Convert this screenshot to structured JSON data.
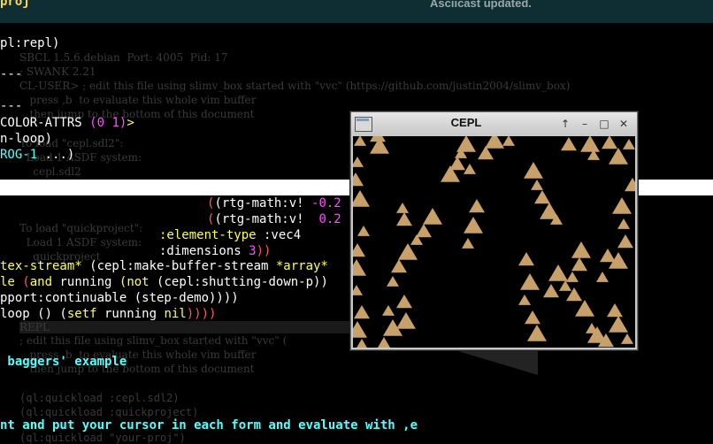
{
  "topbar": {
    "left_text": "proj",
    "right_text": "Asciicast updated."
  },
  "editor": {
    "l1": "pl:repl)",
    "l2": "---",
    "l3": "---",
    "l4a": "COLOR-ATTRS ",
    "l4b": "(0 1)",
    "l4c": ">",
    "l5": "n-loop)",
    "l6a": "ROG-1",
    "l6b": " ...)",
    "l7a": "(rtg-math:v! ",
    "l7b": "-0.2",
    "l8a": "(rtg-math:v!  ",
    "l8b": "0.2",
    "l9a": ":element-type",
    "l9b": " :vec4",
    "l10a": ":dimensions ",
    "l10b": "3",
    "l10c": "))",
    "l11a": "tex-stream*",
    "l11b": " (cepl:make-buffer-stream ",
    "l11c": "*array*",
    "l12a": "le ",
    "l12b": "(",
    "l12c": "and",
    "l12d": " running ",
    "l12e": "(not",
    "l12f": " (cepl:shutting-down-p))",
    "l13": "pport:continuable (step-demo))))",
    "l14a": "loop () (",
    "l14b": "setf",
    "l14c": " running ",
    "l14d": "nil",
    "l14e": "))))",
    "l15": " baggers' example",
    "l16": "nt and put your cursor in each form and evaluate with ,e"
  },
  "background_text": {
    "d1": "SBCL 1.5.6.debian  Port: 4005  Pid: 17",
    "d2": "; SWANK 2.21",
    "d3": "CL-USER> ; edit this file using slimv_box started with \"vvc\" (https://github.com/justin2004/slimv_box)",
    "d4": "   press ,b  to evaluate this whole vim buffer",
    "d5": "   then jump to the bottom of this document",
    "d6": "To load \"cepl.sdl2\":",
    "d7": "  Load 1 ASDF system:",
    "d8": "    cepl.sdl2",
    "d9": "To load \"quickproject\":",
    "d10": "  Load 1 ASDF system:",
    "d11": "    quickproject",
    "d12": "REPL",
    "d13": "; edit this file using slimv_box started with \"vvc\" (",
    "d14": "   press ,b  to evaluate this whole vim buffer",
    "d15": "   then jump to the bottom of this document",
    "d16": "(ql:quickload :cepl.sdl2)",
    "d17": "(ql:quickload :quickproject)",
    "d18": "(ql:quickload \"your-proj\")"
  },
  "window": {
    "title": "CEPL",
    "up": "↑",
    "min": "–",
    "max": "□",
    "close": "✕"
  },
  "colors": {
    "triangle": "#c8a06a",
    "background": "#000000"
  }
}
